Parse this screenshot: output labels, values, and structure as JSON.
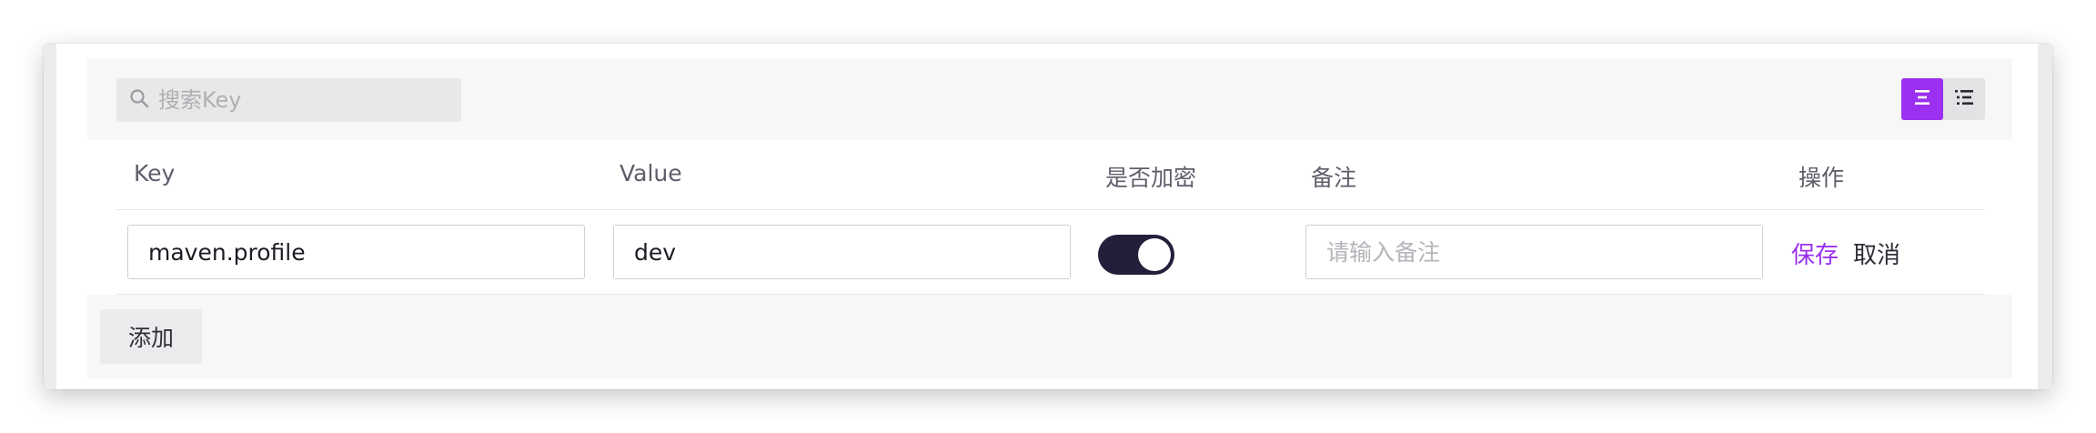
{
  "search": {
    "placeholder": "搜索Key"
  },
  "colors": {
    "accent": "#9b30f0",
    "toggle_on": "#231f3b"
  },
  "view_toggle": {
    "options": [
      "list-view",
      "detail-view"
    ],
    "active": "list-view"
  },
  "table": {
    "columns": [
      "Key",
      "Value",
      "是否加密",
      "备注",
      "操作"
    ],
    "edit_row": {
      "key": "maven.profile",
      "value": "dev",
      "encrypted": true,
      "remark_placeholder": "请输入备注",
      "save_label": "保存",
      "cancel_label": "取消"
    }
  },
  "add_label": "添加"
}
